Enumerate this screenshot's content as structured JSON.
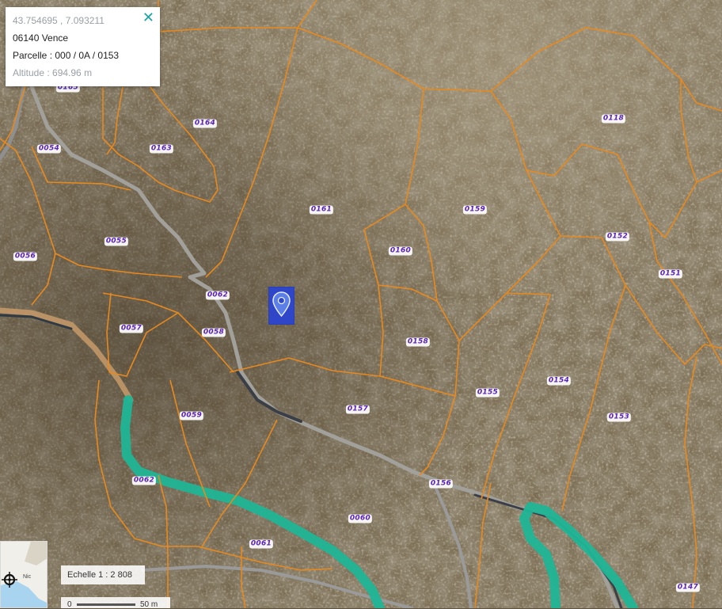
{
  "popup": {
    "coordinates": "43.754695 , 7.093211",
    "commune": "06140 Vence",
    "parcelle": "Parcelle : 000 / 0A / 0153",
    "altitude": "Altitude : 694.96 m",
    "close_icon": "✕"
  },
  "parcels": [
    "0164",
    "0163",
    "0054",
    "0055",
    "0056",
    "0057",
    "0058",
    "0059",
    "0060",
    "0061",
    "0062",
    "0157",
    "0158",
    "0159",
    "0160",
    "0161",
    "0118",
    "0152",
    "0151",
    "0154",
    "0155",
    "0153",
    "0156",
    "0147",
    "0165",
    "0062"
  ],
  "minimap": {
    "label": "Nic"
  },
  "scale": {
    "ratio": "Echelle 1 : 2 808",
    "zero": "0",
    "fifty": "50 m"
  },
  "colors": {
    "parcel_border": "#e8891e",
    "road": "#9a9a9a",
    "river": "#1fb596",
    "label": "#5a23b8",
    "marker": "#2f46c9"
  }
}
